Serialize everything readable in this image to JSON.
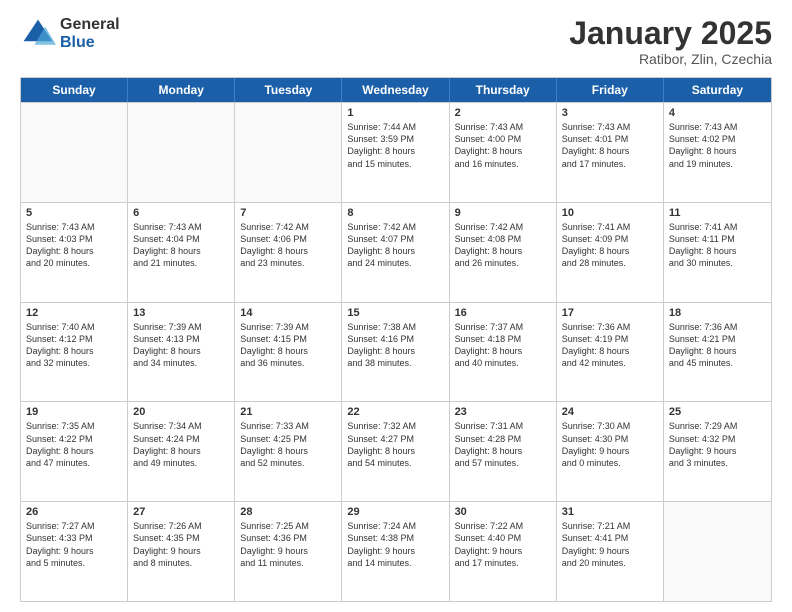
{
  "logo": {
    "general": "General",
    "blue": "Blue"
  },
  "header": {
    "month": "January 2025",
    "location": "Ratibor, Zlin, Czechia"
  },
  "days_of_week": [
    "Sunday",
    "Monday",
    "Tuesday",
    "Wednesday",
    "Thursday",
    "Friday",
    "Saturday"
  ],
  "weeks": [
    [
      {
        "day": "",
        "info": ""
      },
      {
        "day": "",
        "info": ""
      },
      {
        "day": "",
        "info": ""
      },
      {
        "day": "1",
        "info": "Sunrise: 7:44 AM\nSunset: 3:59 PM\nDaylight: 8 hours\nand 15 minutes."
      },
      {
        "day": "2",
        "info": "Sunrise: 7:43 AM\nSunset: 4:00 PM\nDaylight: 8 hours\nand 16 minutes."
      },
      {
        "day": "3",
        "info": "Sunrise: 7:43 AM\nSunset: 4:01 PM\nDaylight: 8 hours\nand 17 minutes."
      },
      {
        "day": "4",
        "info": "Sunrise: 7:43 AM\nSunset: 4:02 PM\nDaylight: 8 hours\nand 19 minutes."
      }
    ],
    [
      {
        "day": "5",
        "info": "Sunrise: 7:43 AM\nSunset: 4:03 PM\nDaylight: 8 hours\nand 20 minutes."
      },
      {
        "day": "6",
        "info": "Sunrise: 7:43 AM\nSunset: 4:04 PM\nDaylight: 8 hours\nand 21 minutes."
      },
      {
        "day": "7",
        "info": "Sunrise: 7:42 AM\nSunset: 4:06 PM\nDaylight: 8 hours\nand 23 minutes."
      },
      {
        "day": "8",
        "info": "Sunrise: 7:42 AM\nSunset: 4:07 PM\nDaylight: 8 hours\nand 24 minutes."
      },
      {
        "day": "9",
        "info": "Sunrise: 7:42 AM\nSunset: 4:08 PM\nDaylight: 8 hours\nand 26 minutes."
      },
      {
        "day": "10",
        "info": "Sunrise: 7:41 AM\nSunset: 4:09 PM\nDaylight: 8 hours\nand 28 minutes."
      },
      {
        "day": "11",
        "info": "Sunrise: 7:41 AM\nSunset: 4:11 PM\nDaylight: 8 hours\nand 30 minutes."
      }
    ],
    [
      {
        "day": "12",
        "info": "Sunrise: 7:40 AM\nSunset: 4:12 PM\nDaylight: 8 hours\nand 32 minutes."
      },
      {
        "day": "13",
        "info": "Sunrise: 7:39 AM\nSunset: 4:13 PM\nDaylight: 8 hours\nand 34 minutes."
      },
      {
        "day": "14",
        "info": "Sunrise: 7:39 AM\nSunset: 4:15 PM\nDaylight: 8 hours\nand 36 minutes."
      },
      {
        "day": "15",
        "info": "Sunrise: 7:38 AM\nSunset: 4:16 PM\nDaylight: 8 hours\nand 38 minutes."
      },
      {
        "day": "16",
        "info": "Sunrise: 7:37 AM\nSunset: 4:18 PM\nDaylight: 8 hours\nand 40 minutes."
      },
      {
        "day": "17",
        "info": "Sunrise: 7:36 AM\nSunset: 4:19 PM\nDaylight: 8 hours\nand 42 minutes."
      },
      {
        "day": "18",
        "info": "Sunrise: 7:36 AM\nSunset: 4:21 PM\nDaylight: 8 hours\nand 45 minutes."
      }
    ],
    [
      {
        "day": "19",
        "info": "Sunrise: 7:35 AM\nSunset: 4:22 PM\nDaylight: 8 hours\nand 47 minutes."
      },
      {
        "day": "20",
        "info": "Sunrise: 7:34 AM\nSunset: 4:24 PM\nDaylight: 8 hours\nand 49 minutes."
      },
      {
        "day": "21",
        "info": "Sunrise: 7:33 AM\nSunset: 4:25 PM\nDaylight: 8 hours\nand 52 minutes."
      },
      {
        "day": "22",
        "info": "Sunrise: 7:32 AM\nSunset: 4:27 PM\nDaylight: 8 hours\nand 54 minutes."
      },
      {
        "day": "23",
        "info": "Sunrise: 7:31 AM\nSunset: 4:28 PM\nDaylight: 8 hours\nand 57 minutes."
      },
      {
        "day": "24",
        "info": "Sunrise: 7:30 AM\nSunset: 4:30 PM\nDaylight: 9 hours\nand 0 minutes."
      },
      {
        "day": "25",
        "info": "Sunrise: 7:29 AM\nSunset: 4:32 PM\nDaylight: 9 hours\nand 3 minutes."
      }
    ],
    [
      {
        "day": "26",
        "info": "Sunrise: 7:27 AM\nSunset: 4:33 PM\nDaylight: 9 hours\nand 5 minutes."
      },
      {
        "day": "27",
        "info": "Sunrise: 7:26 AM\nSunset: 4:35 PM\nDaylight: 9 hours\nand 8 minutes."
      },
      {
        "day": "28",
        "info": "Sunrise: 7:25 AM\nSunset: 4:36 PM\nDaylight: 9 hours\nand 11 minutes."
      },
      {
        "day": "29",
        "info": "Sunrise: 7:24 AM\nSunset: 4:38 PM\nDaylight: 9 hours\nand 14 minutes."
      },
      {
        "day": "30",
        "info": "Sunrise: 7:22 AM\nSunset: 4:40 PM\nDaylight: 9 hours\nand 17 minutes."
      },
      {
        "day": "31",
        "info": "Sunrise: 7:21 AM\nSunset: 4:41 PM\nDaylight: 9 hours\nand 20 minutes."
      },
      {
        "day": "",
        "info": ""
      }
    ]
  ]
}
